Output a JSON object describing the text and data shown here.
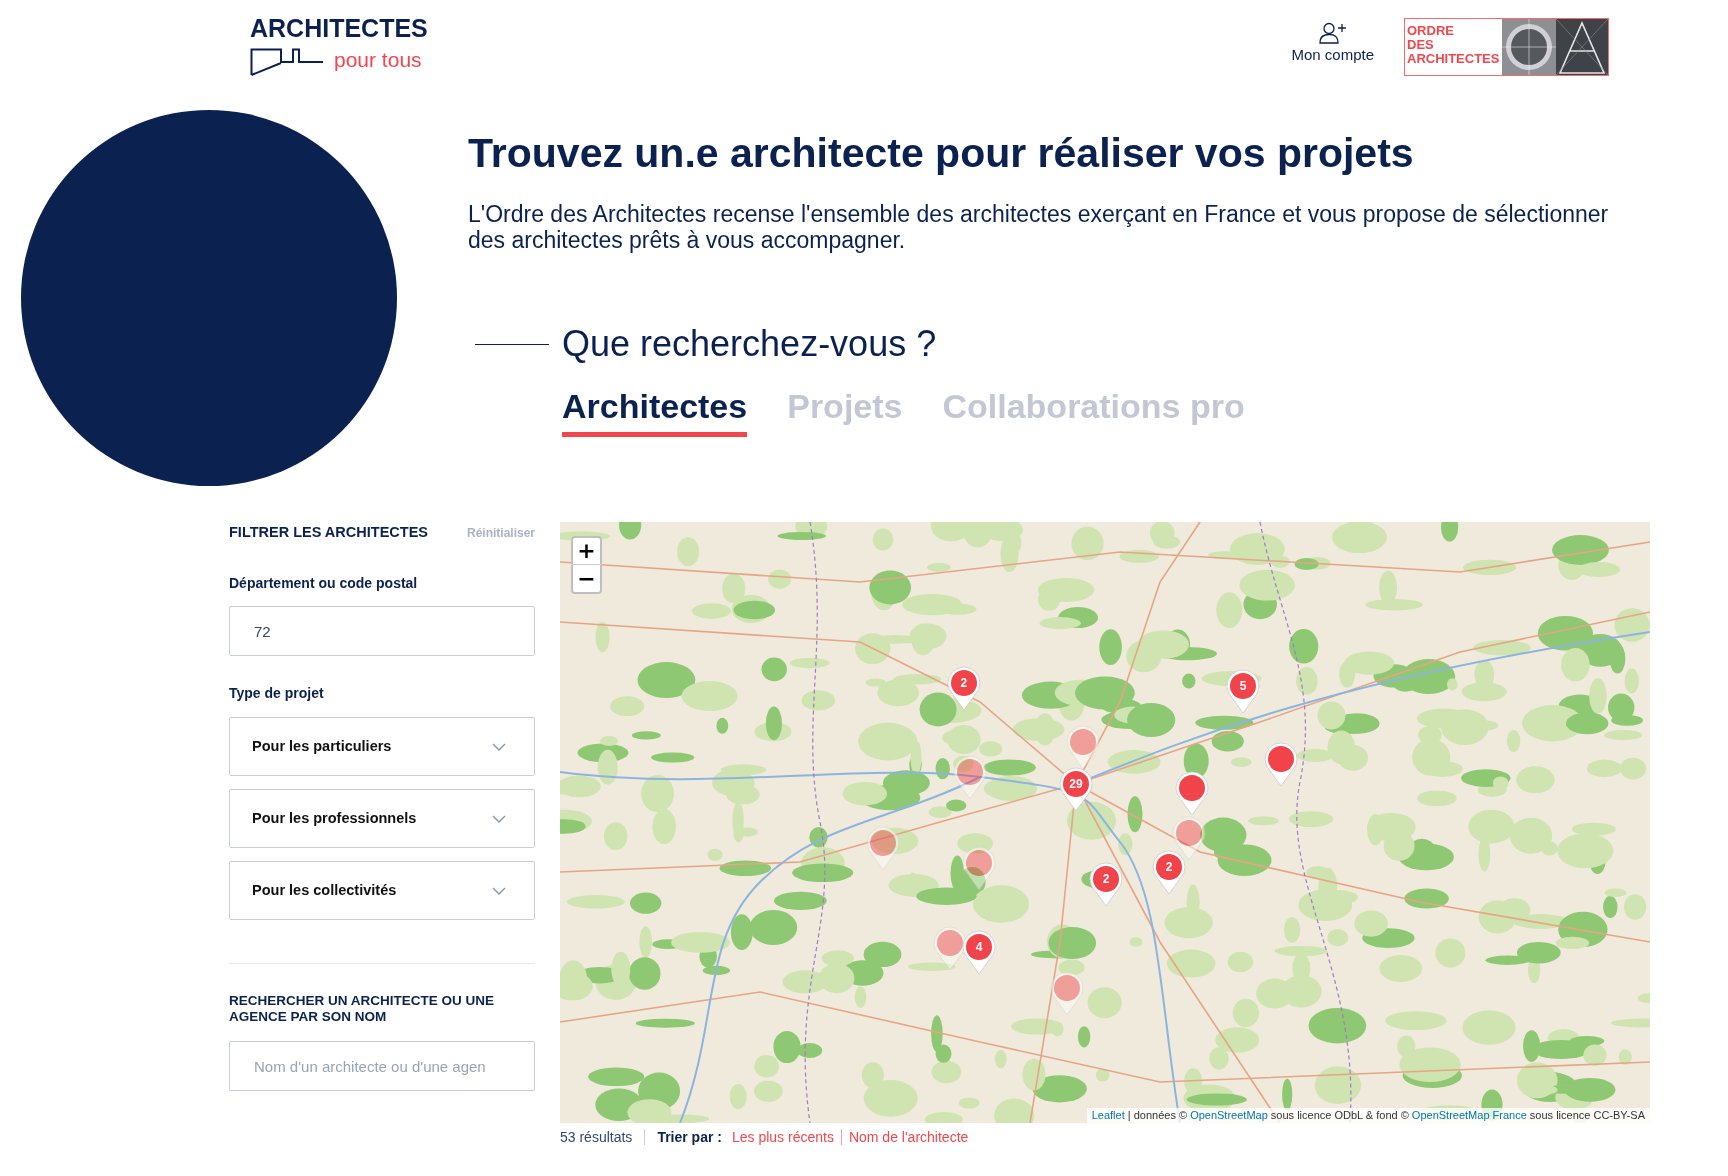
{
  "header": {
    "logo": {
      "title": "ARCHITECTES",
      "subtitle": "pour tous"
    },
    "account_link": "Mon compte",
    "org_logo": {
      "lines": [
        "ORDRE",
        "DES",
        "ARCHITECTES"
      ]
    }
  },
  "hero": {
    "title": "Trouvez un.e architecte pour réaliser vos projets",
    "intro": "L'Ordre des Architectes recense l'ensemble des architectes exerçant en France et vous propose de sélectionner des architectes prêts à vous accompagner.",
    "search_heading": "Que recherchez-vous ?",
    "tabs": [
      {
        "label": "Architectes",
        "selected": true
      },
      {
        "label": "Projets",
        "selected": false
      },
      {
        "label": "Collaborations pro",
        "selected": false
      }
    ]
  },
  "filters": {
    "title": "FILTRER LES ARCHITECTES",
    "reset": "Réinitialiser",
    "postal": {
      "label": "Département ou code postal",
      "value": "72"
    },
    "project_type": {
      "label": "Type de projet",
      "options": [
        {
          "label": "Pour les particuliers",
          "expanded": false
        },
        {
          "label": "Pour les professionnels",
          "expanded": false
        },
        {
          "label": "Pour les collectivités",
          "expanded": false
        }
      ]
    },
    "name_search": {
      "title": "RECHERCHER UN ARCHITECTE OU UNE AGENCE PAR SON NOM",
      "placeholder": "Nom d'un architecte ou d'une agen"
    }
  },
  "map": {
    "zoom_in": "+",
    "zoom_out": "−",
    "markers": [
      {
        "label": "2",
        "dimmed": false
      },
      {
        "label": "5",
        "dimmed": false
      },
      {
        "dimmed": true
      },
      {
        "dimmed": false
      },
      {
        "dimmed": true
      },
      {
        "label": "29",
        "dimmed": false
      },
      {
        "dimmed": false
      },
      {
        "dimmed": true
      },
      {
        "dimmed": true
      },
      {
        "dimmed": true
      },
      {
        "label": "2",
        "dimmed": false
      },
      {
        "label": "2",
        "dimmed": false
      },
      {
        "dimmed": true
      },
      {
        "label": "4",
        "dimmed": false
      },
      {
        "dimmed": true
      }
    ],
    "attribution": [
      {
        "kind": "link",
        "text": "Leaflet"
      },
      {
        "kind": "text",
        "text": "| données ©"
      },
      {
        "kind": "link",
        "text": "OpenStreetMap"
      },
      {
        "kind": "text",
        "text": "sous licence ODbL & fond ©"
      },
      {
        "kind": "link",
        "text": "OpenStreetMap France"
      },
      {
        "kind": "text",
        "text": "sous licence CC-BY-SA"
      }
    ]
  },
  "results": {
    "count": "53 résultats",
    "sort_label": "Trier par :",
    "sort_options": [
      "Les plus récents",
      "Nom de l'architecte"
    ]
  }
}
